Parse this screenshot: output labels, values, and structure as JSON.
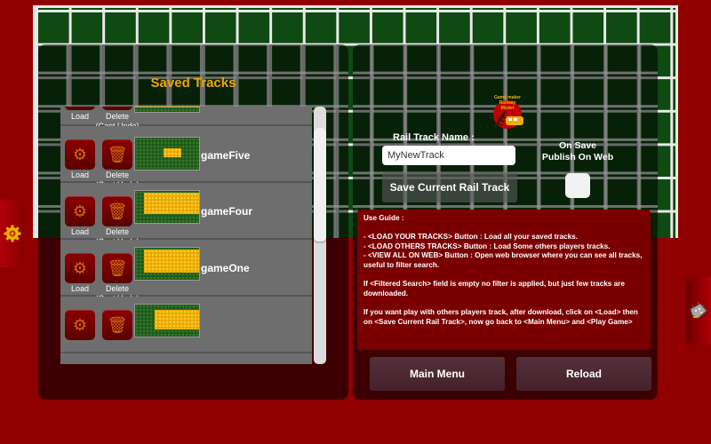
{
  "screen": {
    "background_color": "#900000",
    "board_color": "#0e4a12",
    "accent_color": "#f0a500"
  },
  "saved_tracks": {
    "title": "Saved Tracks",
    "load_label": "Load",
    "delete_label": "Delete",
    "delete_note": "(Cant Undo)",
    "rows": [
      {
        "name": ""
      },
      {
        "name": "gameFive"
      },
      {
        "name": "gameFour"
      },
      {
        "name": "gameOne"
      },
      {
        "name": ""
      }
    ]
  },
  "save_panel": {
    "logo_text": "Game maker Railway Model",
    "field_label": "Rail Track Name :",
    "track_name_value": "MyNewTrack",
    "save_button": "Save Current Rail Track",
    "publish_label_line1": "On Save",
    "publish_label_line2": "Publish On Web",
    "publish_checked": false
  },
  "guide": {
    "heading": "Use Guide :",
    "lines": [
      "- <LOAD YOUR TRACKS> Button : Load all your saved tracks.",
      "- <LOAD OTHERS TRACKS> Button : Load Some others players  tracks.",
      "- <VIEW ALL ON WEB> Button : Open web browser where you can see all tracks, useful to filter search."
    ],
    "filter_note": "If <Filtered Search> field is empty no filter is applied, but just few tracks are downloaded.",
    "play_note": "If you want play with others players track, after download, click on <Load> then on <Save Current Rail Track>, now go back to <Main Menu> and <Play Game>"
  },
  "buttons": {
    "main_menu": "Main Menu",
    "reload": "Reload"
  },
  "side_tabs": {
    "left_icon": "gear-icon",
    "right_icon": "train-wreck-icon"
  }
}
